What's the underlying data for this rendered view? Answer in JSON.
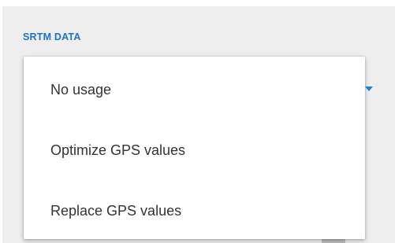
{
  "section": {
    "title": "SRTM DATA"
  },
  "menu": {
    "items": [
      {
        "label": "No usage"
      },
      {
        "label": "Optimize GPS values"
      },
      {
        "label": "Replace GPS values"
      }
    ]
  },
  "underlying": {
    "partial_text": "━━━━ ━━━━"
  },
  "colors": {
    "accent": "#1a73c9",
    "panel_background": "#eeeeee",
    "popup_background": "#ffffff",
    "item_text": "#333333"
  },
  "icons": {
    "spinner": "dropdown-arrow-icon"
  }
}
